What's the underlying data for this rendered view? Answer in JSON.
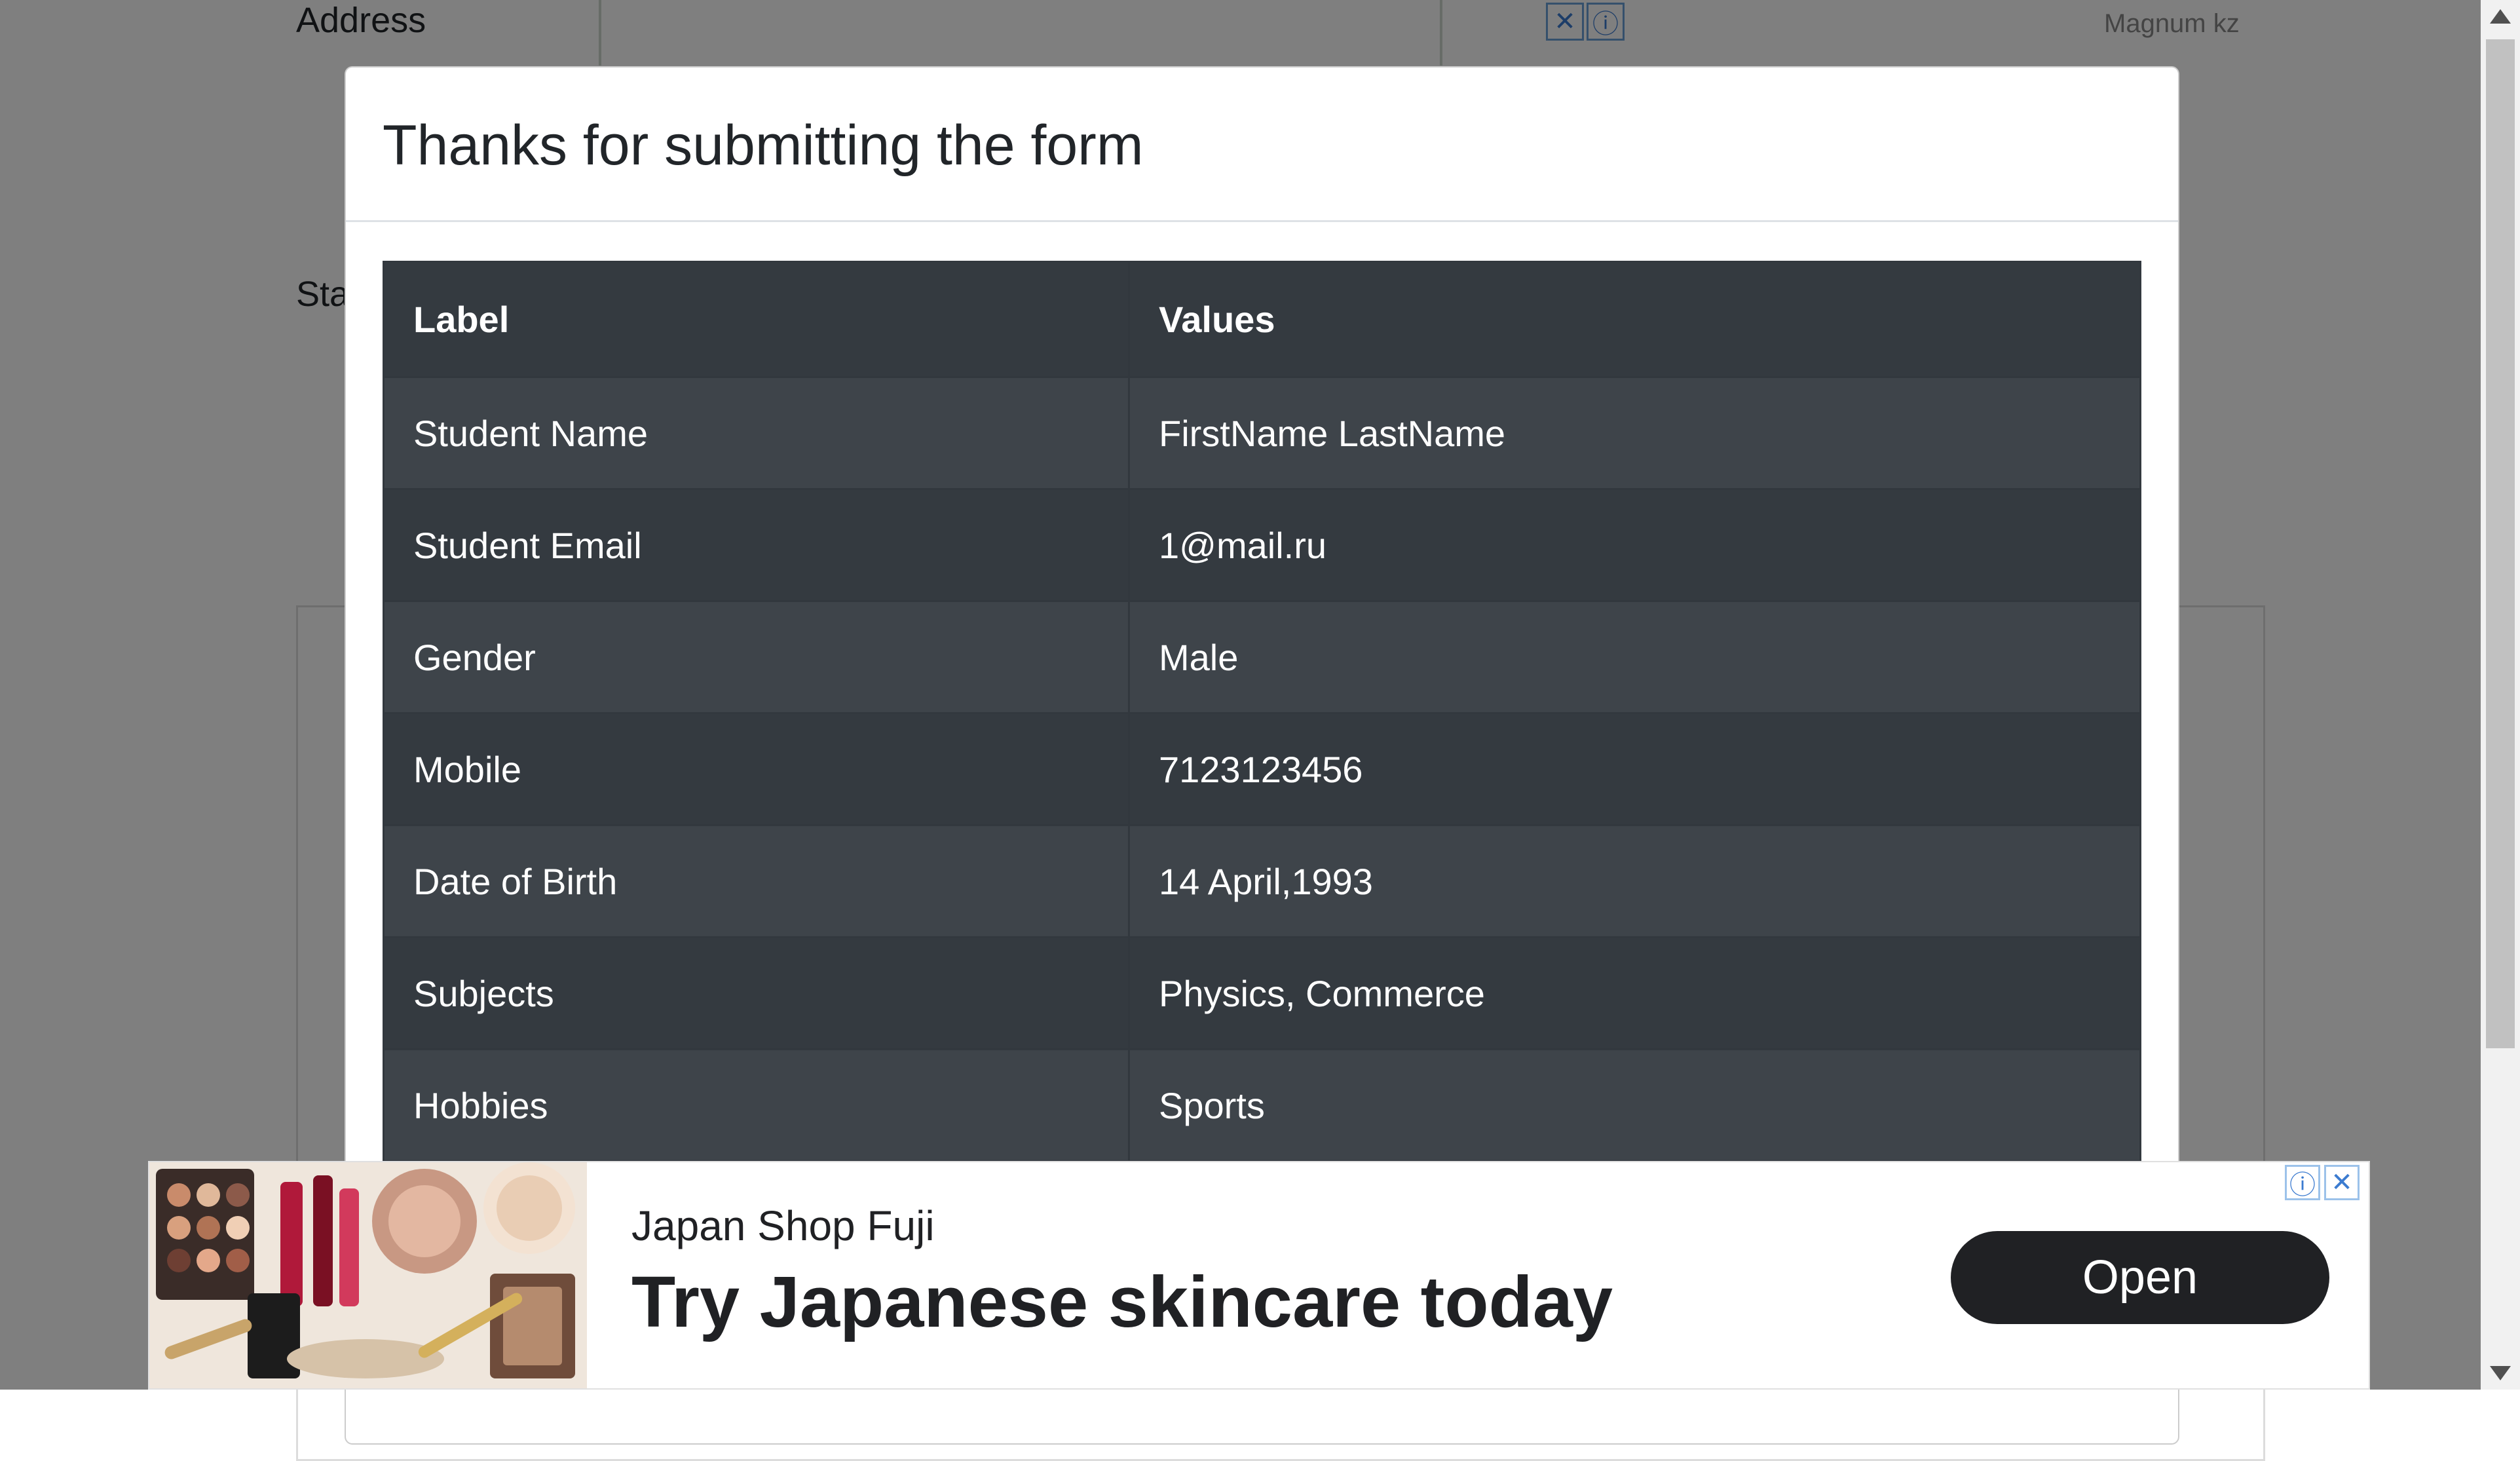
{
  "background": {
    "address_label": "Address",
    "state_label_fragment": "Sta",
    "top_ad_label": "Magnum kz",
    "top_ad_icons": [
      "close-icon",
      "info-icon"
    ]
  },
  "modal": {
    "title": "Thanks for submitting the form",
    "table": {
      "headers": [
        "Label",
        "Values"
      ],
      "rows": [
        [
          "Student Name",
          "FirstName LastName"
        ],
        [
          "Student Email",
          "1@mail.ru"
        ],
        [
          "Gender",
          "Male"
        ],
        [
          "Mobile",
          "7123123456"
        ],
        [
          "Date of Birth",
          "14 April,1993"
        ],
        [
          "Subjects",
          "Physics, Commerce"
        ],
        [
          "Hobbies",
          "Sports"
        ]
      ]
    }
  },
  "ad": {
    "brand": "Japan Shop Fuji",
    "headline": "Try Japanese skincare today",
    "button_label": "Open",
    "icons": [
      "info-icon",
      "close-icon"
    ]
  },
  "colors": {
    "table_dark": "#343a40",
    "table_row_alt": "#3e444a",
    "button_dark": "#202124",
    "backdrop": "rgba(0,0,0,0.5)"
  }
}
